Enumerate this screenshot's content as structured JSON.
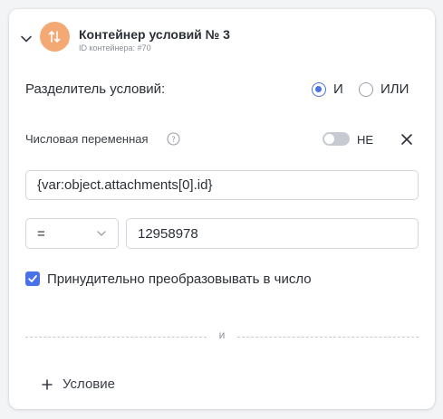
{
  "container": {
    "title": "Контейнер условий № 3",
    "subtitle": "ID контейнера: #70",
    "icon": "sort-arrows-icon",
    "accent_color": "#f4a975"
  },
  "separator": {
    "label": "Разделитель условий:",
    "options": [
      {
        "label": "И",
        "selected": true
      },
      {
        "label": "ИЛИ",
        "selected": false
      }
    ]
  },
  "condition": {
    "type_label": "Числовая переменная",
    "not_toggle": {
      "label": "НЕ",
      "enabled": false
    },
    "expression": "{var:object.attachments[0].id}",
    "operator": "=",
    "value": "12958978",
    "force_number": {
      "label": "Принудительно преобразовывать в число",
      "checked": true
    }
  },
  "divider_text": "и",
  "add_condition_label": "Условие",
  "colors": {
    "primary": "#4a72e8",
    "border": "#d3d6db"
  }
}
